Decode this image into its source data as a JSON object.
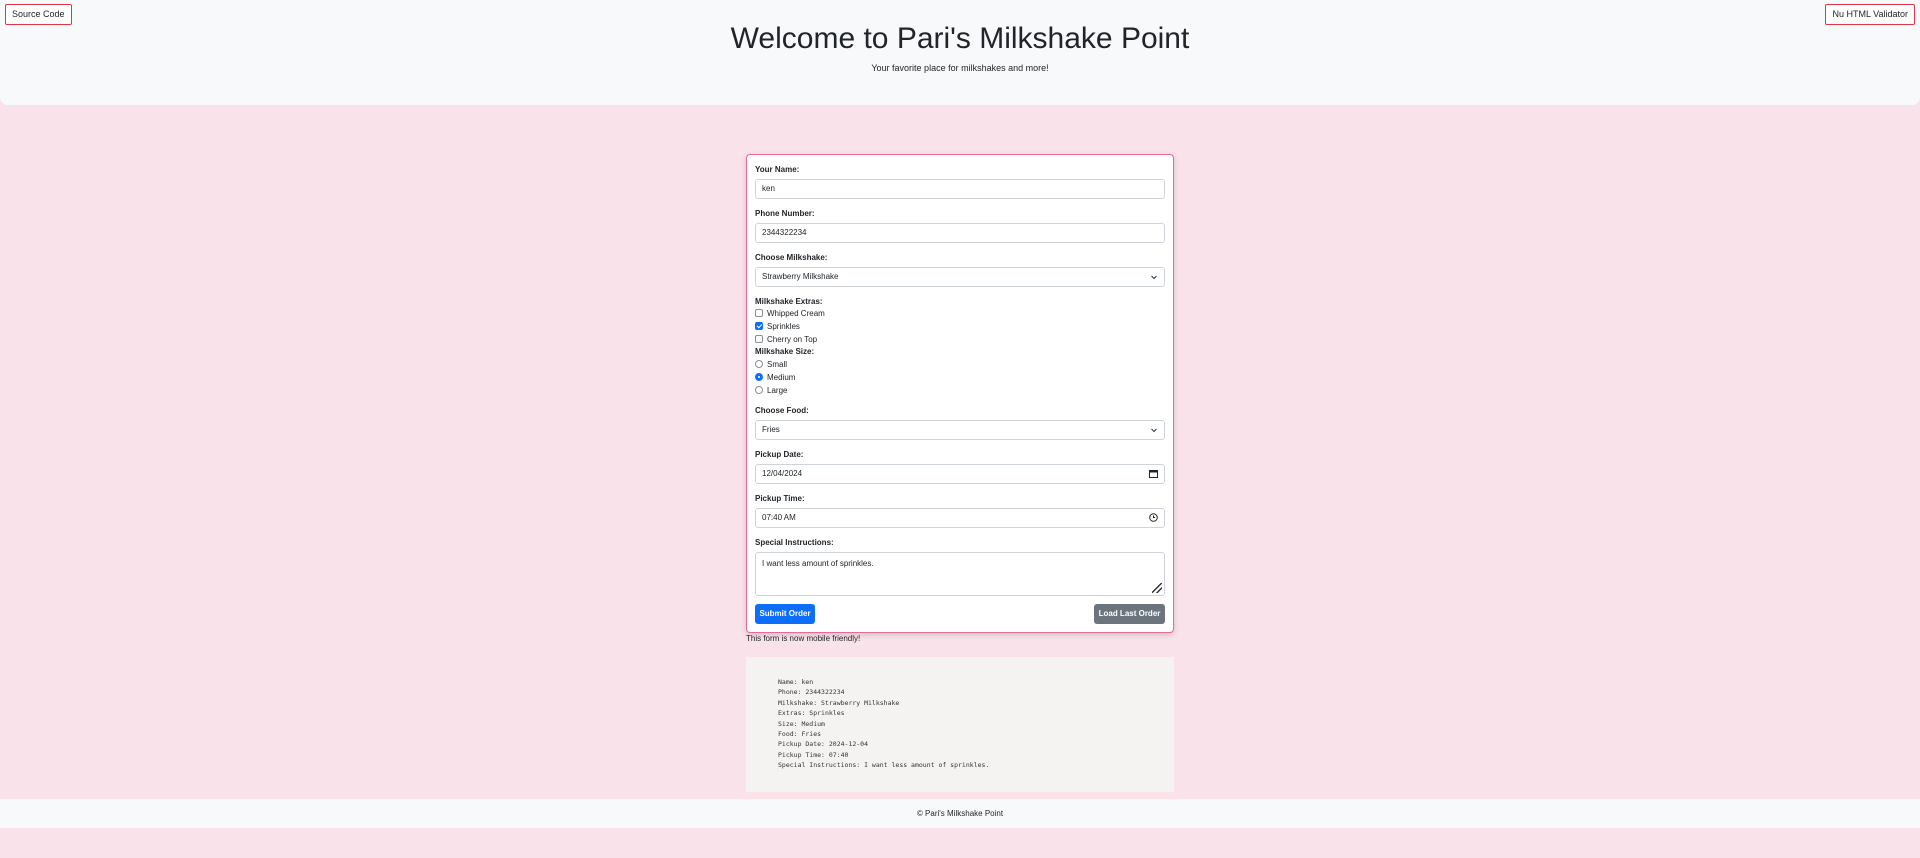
{
  "links": {
    "source_code": "Source Code",
    "validator": "Nu HTML Validator"
  },
  "header": {
    "title": "Welcome to Pari's Milkshake Point",
    "subtitle": "Your favorite place for milkshakes and more!"
  },
  "form": {
    "name_label": "Your Name:",
    "name_value": "ken",
    "phone_label": "Phone Number:",
    "phone_value": "2344322234",
    "milkshake_label": "Choose Milkshake:",
    "milkshake_value": "Strawberry Milkshake",
    "extras_label": "Milkshake Extras:",
    "extras": [
      {
        "label": "Whipped Cream",
        "checked": false
      },
      {
        "label": "Sprinkles",
        "checked": true
      },
      {
        "label": "Cherry on Top",
        "checked": false
      }
    ],
    "size_label": "Milkshake Size:",
    "sizes": [
      {
        "label": "Small",
        "checked": false
      },
      {
        "label": "Medium",
        "checked": true
      },
      {
        "label": "Large",
        "checked": false
      }
    ],
    "food_label": "Choose Food:",
    "food_value": "Fries",
    "date_label": "Pickup Date:",
    "date_value": "12/04/2024",
    "time_label": "Pickup Time:",
    "time_value": "07:40 AM",
    "instructions_label": "Special Instructions:",
    "instructions_value": "I want less amount of sprinkles.",
    "submit_label": "Submit Order",
    "load_label": "Load Last Order",
    "icons": {
      "dropdown": "chevron-down-icon",
      "calendar": "calendar-icon",
      "clock": "clock-icon"
    }
  },
  "mobile_note": "This form is now mobile friendly!",
  "summary": [
    "Name: ken",
    "Phone: 2344322234",
    "Milkshake: Strawberry Milkshake",
    "Extras: Sprinkles",
    "Size: Medium",
    "Food: Fries",
    "Pickup Date: 2024-12-04",
    "Pickup Time: 07:40",
    "Special Instructions: I want less amount of sprinkles."
  ],
  "footer": "© Pari's Milkshake Point",
  "colors": {
    "page_bg": "#f9e2ea",
    "accent": "#0d6efd",
    "card_border": "#e86a9a",
    "secondary": "#6c757d"
  }
}
